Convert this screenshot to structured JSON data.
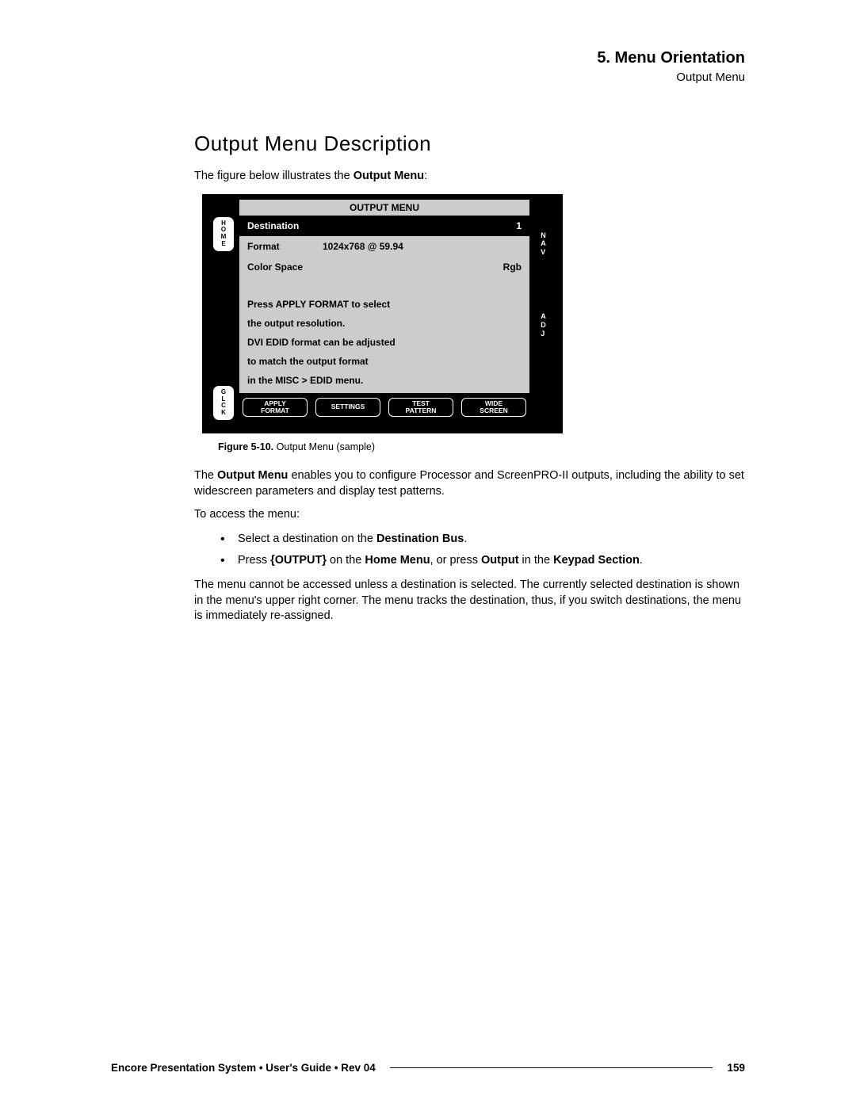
{
  "header": {
    "chapter": "5.  Menu Orientation",
    "section": "Output Menu"
  },
  "title": "Output Menu Description",
  "intro_pre": "The figure below illustrates the ",
  "intro_bold": "Output Menu",
  "intro_post": ":",
  "menu": {
    "title": "OUTPUT MENU",
    "left_home": "H\nO\nM\nE",
    "left_glck": "G\nL\nC\nK",
    "right_nav": "N\nA\nV",
    "right_adj": "A\nD\nJ",
    "rows": [
      {
        "label": "Destination",
        "value": "",
        "right": "1"
      },
      {
        "label": "Format",
        "value": "1024x768 @ 59.94",
        "right": ""
      },
      {
        "label": "Color Space",
        "value": "",
        "right": "Rgb"
      }
    ],
    "info": "Press APPLY FORMAT to select\nthe output resolution.\nDVI EDID format can be adjusted\nto match the output format\nin the MISC > EDID menu.",
    "buttons": [
      "APPLY\nFORMAT",
      "SETTINGS",
      "TEST\nPATTERN",
      "WIDE\nSCREEN"
    ]
  },
  "figure": {
    "label": "Figure 5-10.",
    "caption": "Output Menu  (sample)"
  },
  "para1_pre": "The ",
  "para1_bold": "Output Menu",
  "para1_post": " enables you to configure Processor and ScreenPRO-II outputs, including the ability to set widescreen parameters and display test patterns.",
  "para2": "To access the menu:",
  "bullets": {
    "b1_pre": "Select a destination on the ",
    "b1_bold": "Destination Bus",
    "b1_post": ".",
    "b2_t1": "Press ",
    "b2_b1": "{OUTPUT}",
    "b2_t2": " on the ",
    "b2_b2": "Home Menu",
    "b2_t3": ", or press ",
    "b2_b3": "Output",
    "b2_t4": " in the ",
    "b2_b4": "Keypad Section",
    "b2_t5": "."
  },
  "para3": "The menu cannot be accessed unless a destination is selected.  The currently selected destination is shown in the menu's upper right corner.  The menu tracks the destination, thus, if you switch destinations, the menu is immediately re-assigned.",
  "footer": {
    "doc": "Encore Presentation System  •  User's Guide  •  Rev 04",
    "page": "159"
  }
}
